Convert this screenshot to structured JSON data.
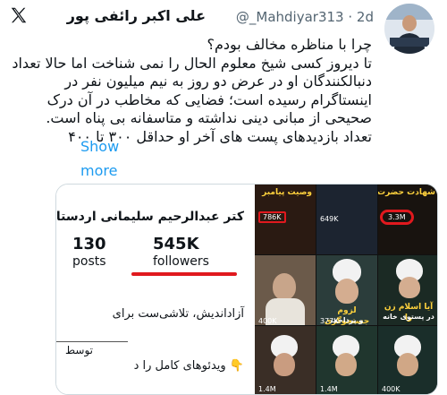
{
  "author": {
    "display_name": "علی اکبر رائفی پور",
    "handle": "@_Mahdiyar313",
    "age": "2d"
  },
  "tweet": {
    "lines": [
      "چرا با مناظره مخالف بودم؟",
      "تا دیروز کسی شیخ معلوم الحال را نمی شناخت اما حالا تعداد",
      "دنبالکنندگان او در عرض دو روز به نیم میلیون نفر در",
      "اینستاگرام رسیده است؛ فضایی که مخاطب در آن درک",
      "صحیحی از مبانی دینی نداشته و متاسفانه بی پناه است.",
      "تعداد بازدیدهای پست های آخر او حداقل ۳۰۰ تا ۴۰۰"
    ],
    "show_more": [
      "Show",
      "more"
    ]
  },
  "media": {
    "profile": {
      "name": "کتر عبدالرحیم سلیمانی اردستانی",
      "posts_count": "130",
      "posts_label": "posts",
      "followers_count": "545K",
      "followers_label": "followers",
      "bio_line1": "آزاداندیش، تلاشی‌ست برای",
      "bio_line2": "توسط",
      "bio_line3": "👇 ویدئوهای کامل را د"
    },
    "grid": {
      "tile1_title": "وصیت پیامبر",
      "tile1_views": "786K",
      "tile2_views": "649K",
      "tile3_title": "شهادت حضرت زهرا",
      "tile3_views": "3.3M",
      "tile4_caption": [
        "لزوم جستجوگری",
        "و پرداخت",
        "هزینه‌ی حق پرستی"
      ],
      "tile5_caption": [
        "آیا اسلام زن را",
        "در پستوی خانه",
        "می‌خواهد؟"
      ],
      "tile4_views": "377K",
      "tile6_views": "400K",
      "tile7_views": "1.4M",
      "tile8_views": "1.4M",
      "tile9_views": "400K"
    },
    "colors": {
      "highlight": "#e0191e",
      "link": "#1d9bf0"
    }
  }
}
